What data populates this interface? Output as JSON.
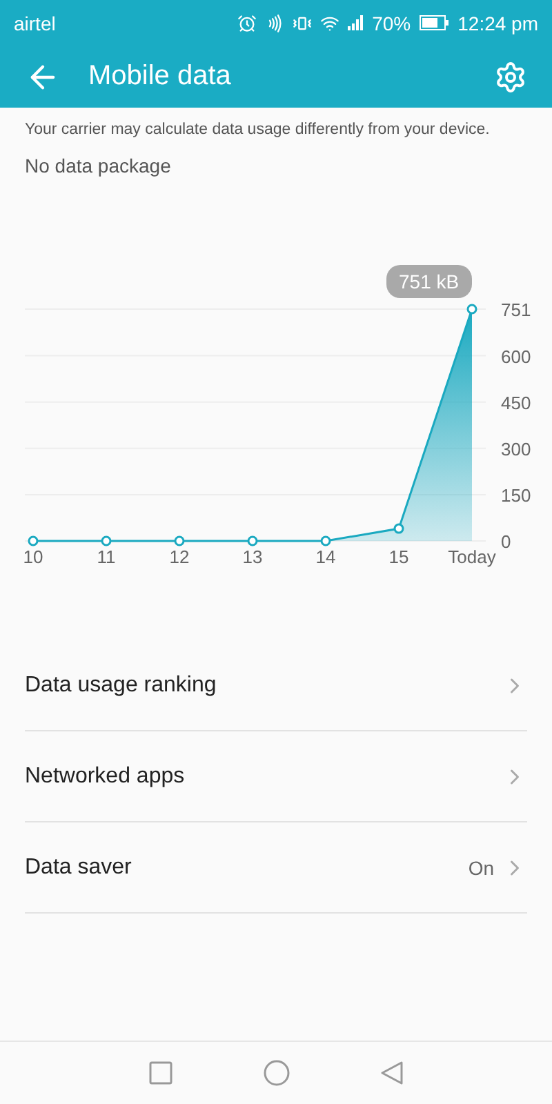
{
  "status_bar": {
    "carrier": "airtel",
    "battery": "70%",
    "time": "12:24 pm"
  },
  "toolbar": {
    "title": "Mobile data"
  },
  "notice": "Your carrier may calculate data usage differently from your device.",
  "package": "No data package",
  "usage_chart": {
    "tooltip": "751 kB",
    "chart_data": {
      "type": "area",
      "categories": [
        "10",
        "11",
        "12",
        "13",
        "14",
        "15",
        "Today"
      ],
      "series": [
        {
          "color": "#1aa9c0",
          "values": [
            0,
            0,
            0,
            0,
            0,
            40,
            751
          ]
        }
      ],
      "ylim": [
        0,
        751
      ],
      "grid": true,
      "yticks": [
        0,
        150,
        300,
        450,
        600,
        751
      ]
    }
  },
  "menu": [
    {
      "label": "Data usage ranking"
    },
    {
      "label": "Networked apps"
    },
    {
      "label": "Data saver",
      "value": "On"
    }
  ]
}
